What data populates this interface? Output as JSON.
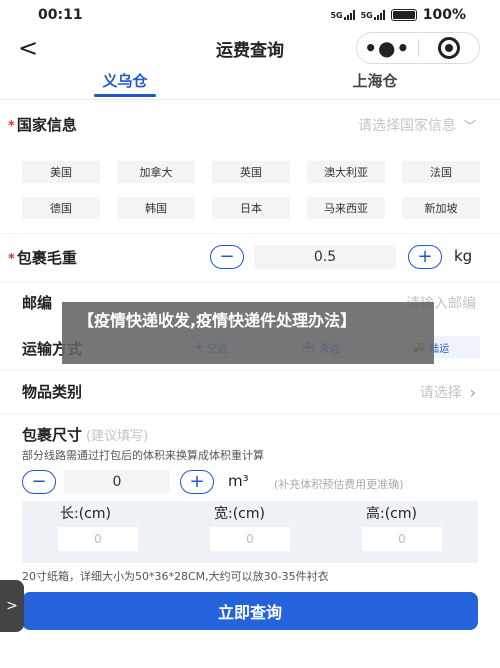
{
  "status_bar": {
    "time": "00:11",
    "signal1": "5G",
    "signal2": "5G",
    "battery": "100%"
  },
  "nav": {
    "back": "<",
    "title": "运费查询",
    "menu_dots": "•●•"
  },
  "tabs": [
    {
      "label": "义乌仓"
    },
    {
      "label": "上海仓"
    }
  ],
  "country": {
    "label": "国家信息",
    "placeholder": "请选择国家信息",
    "options": [
      "美国",
      "加拿大",
      "英国",
      "澳大利亚",
      "法国",
      "德国",
      "韩国",
      "日本",
      "马来西亚",
      "新加坡"
    ]
  },
  "weight": {
    "label": "包裹毛重",
    "value": "0.5",
    "unit": "kg",
    "minus": "−",
    "plus": "+"
  },
  "postcode": {
    "label": "邮编",
    "placeholder": "请输入邮编"
  },
  "transport": {
    "label": "运输方式",
    "options": [
      {
        "icon": "✈",
        "label": "空运"
      },
      {
        "icon": "⛴",
        "label": "海运"
      },
      {
        "icon": "🚚",
        "label": "陆运"
      }
    ]
  },
  "category": {
    "label": "物品类别",
    "placeholder": "请选择"
  },
  "size": {
    "label": "包裹尺寸",
    "hint_label": "(建议填写)",
    "note": "部分线路需通过打包后的体积来换算成体积重计算",
    "count": "0",
    "unit": "m³",
    "unit_note": "(补充体积预估费用更准确)",
    "length_label": "长:(cm)",
    "width_label": "宽:(cm)",
    "height_label": "高:(cm)",
    "length_placeholder": "0",
    "width_placeholder": "0",
    "height_placeholder": "0",
    "example": "20寸纸箱，详细大小为50*36*28CM,大约可以放30-35件衬衣"
  },
  "banner": {
    "text": "【疫情快递收发,疫情快递件处理办法】"
  },
  "submit_label": "立即查询",
  "side_tab": ">"
}
